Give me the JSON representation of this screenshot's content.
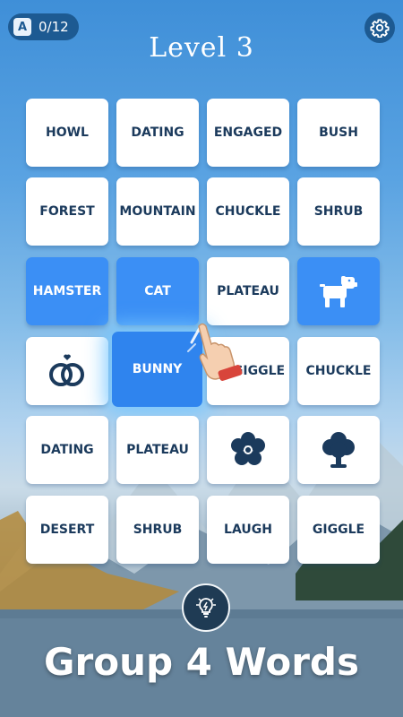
{
  "header": {
    "counter_icon": "A",
    "counter": "0/12",
    "title": "Level 3"
  },
  "grid": {
    "rows": [
      [
        "HOWL",
        "DATING",
        "ENGAGED",
        "BUSH"
      ],
      [
        "FOREST",
        "MOUNTAIN",
        "CHUCKLE",
        "SHRUB"
      ],
      [
        "HAMSTER",
        "CAT",
        "PLATEAU",
        "dog-icon"
      ],
      [
        "rings-icon",
        "BUNNY",
        "GIGGLE",
        "CHUCKLE"
      ],
      [
        "DATING",
        "PLATEAU",
        "flower-icon",
        "tree-icon"
      ],
      [
        "DESERT",
        "SHRUB",
        "LAUGH",
        "GIGGLE"
      ]
    ],
    "selected": [
      "HAMSTER",
      "CAT",
      "dog-icon",
      "BUNNY"
    ],
    "selected_count": 4
  },
  "hint_icon": "lightbulb-icon",
  "caption": "Group 4 Words",
  "colors": {
    "tile": "#ffffff",
    "tile_text": "#1b3a5c",
    "selected": "#3b8ff5",
    "accent_dark": "#1d5a92"
  }
}
